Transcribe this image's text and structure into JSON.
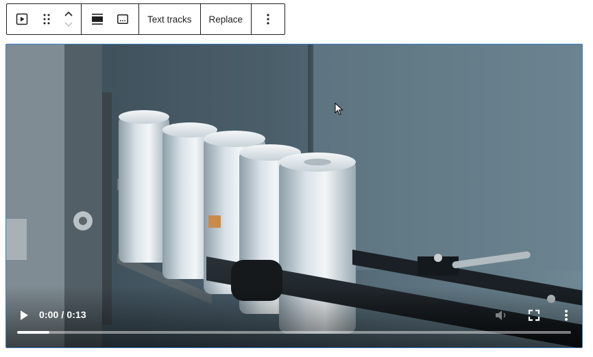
{
  "toolbar": {
    "block_type_icon": "video-play-icon",
    "drag_icon": "drag-handle-icon",
    "move_up_icon": "chevron-up-icon",
    "move_down_icon": "chevron-down-icon",
    "align_icon": "align-wide-icon",
    "caption_icon": "caption-icon",
    "text_tracks_label": "Text tracks",
    "replace_label": "Replace",
    "options_icon": "more-vertical-icon"
  },
  "video": {
    "time_display": "0:00 / 0:13",
    "progress_fraction": 0.058,
    "play_icon": "play-icon",
    "volume_icon": "volume-muted-icon",
    "fullscreen_icon": "fullscreen-icon",
    "more_icon": "more-vertical-icon",
    "accent": "#3a7bbf"
  }
}
